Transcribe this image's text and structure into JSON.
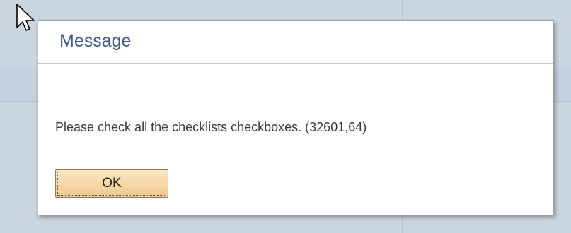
{
  "dialog": {
    "title": "Message",
    "message": "Please check all the checklists checkboxes. (32601,64)",
    "ok_label": "OK"
  },
  "colors": {
    "title": "#3f5b8a",
    "button_top": "#fbe7c7",
    "button_bottom": "#efc88b",
    "background": "#ccd6e3"
  },
  "cursor": {
    "icon": "arrow-pointer-icon"
  }
}
